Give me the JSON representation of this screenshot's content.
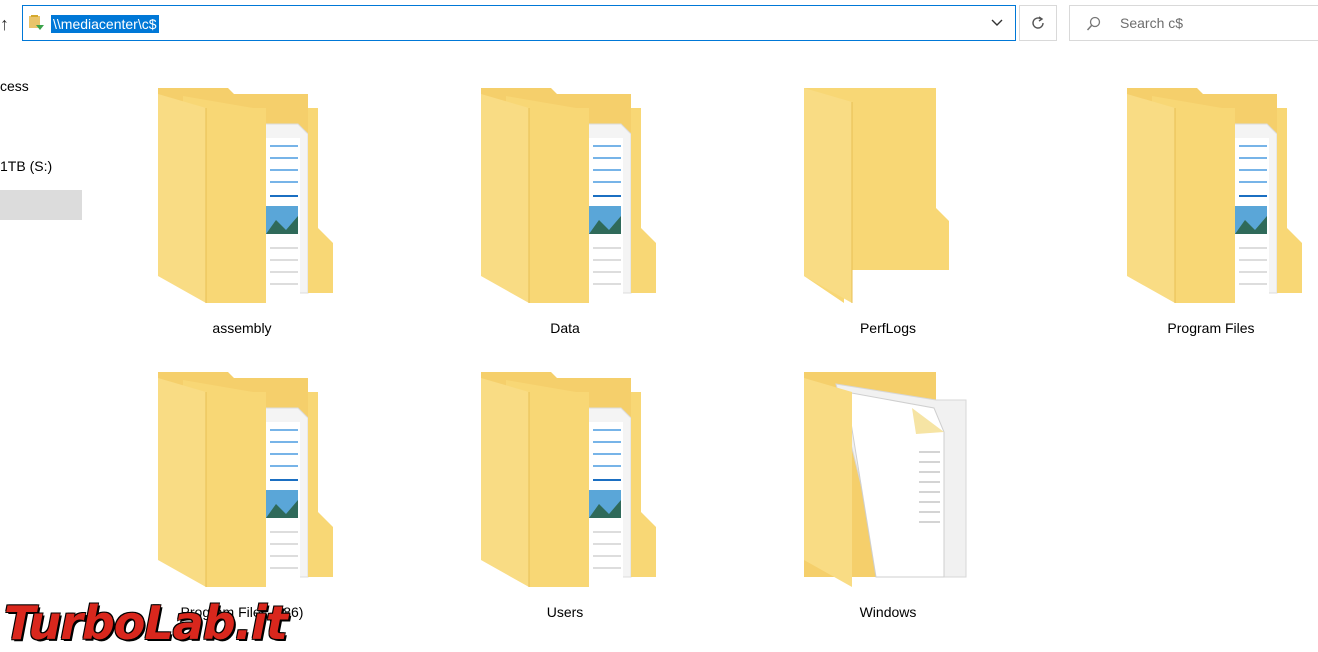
{
  "address_bar": {
    "path": "\\\\mediacenter\\c$"
  },
  "search": {
    "placeholder": "Search c$"
  },
  "nav": {
    "items": [
      {
        "label": "cess"
      },
      {
        "label": "1TB (S:)"
      }
    ]
  },
  "folders": [
    {
      "name": "assembly",
      "icon": "folder-with-documents-icon"
    },
    {
      "name": "Data",
      "icon": "folder-with-documents-icon"
    },
    {
      "name": "PerfLogs",
      "icon": "empty-folder-icon"
    },
    {
      "name": "Program Files",
      "icon": "folder-with-documents-icon"
    },
    {
      "name": "Program Files (x86)",
      "icon": "folder-with-documents-icon"
    },
    {
      "name": "Users",
      "icon": "folder-with-documents-icon"
    },
    {
      "name": "Windows",
      "icon": "folder-with-files-icon"
    }
  ],
  "watermark": {
    "text": "TurboLab.it"
  },
  "colors": {
    "accent": "#0078d7",
    "folder": "#f8d775",
    "watermark": "#d9271d"
  }
}
